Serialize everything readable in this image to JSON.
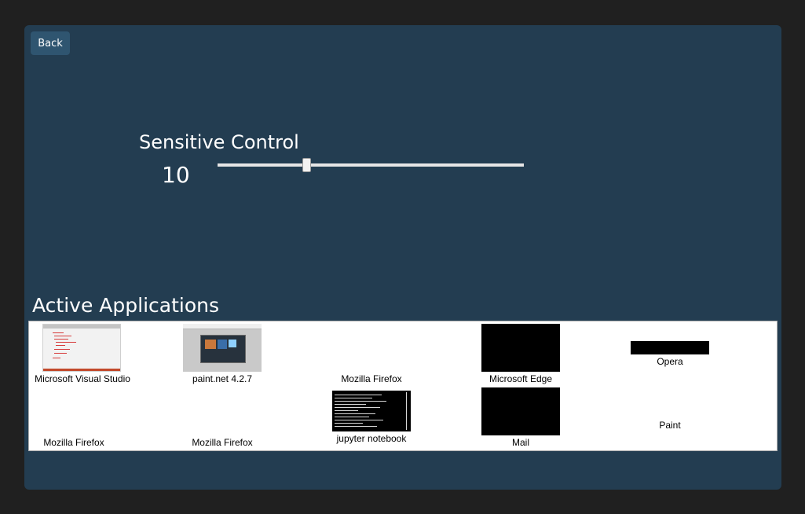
{
  "back_button": {
    "label": "Back"
  },
  "slider": {
    "label": "Sensitive Control",
    "value": "10",
    "fraction": 0.29
  },
  "active_applications": {
    "heading": "Active Applications",
    "tiles": [
      {
        "label": "Microsoft Visual Studio",
        "thumbnail": "code-editor-screenshot"
      },
      {
        "label": "paint.net 4.2.7",
        "thumbnail": "image-editor-screenshot"
      },
      {
        "label": "Mozilla Firefox",
        "thumbnail": "none"
      },
      {
        "label": "Microsoft Edge",
        "thumbnail": "black"
      },
      {
        "label": "Opera",
        "thumbnail": "black-bar"
      },
      {
        "label": "Mozilla Firefox",
        "thumbnail": "none"
      },
      {
        "label": "Mozilla Firefox",
        "thumbnail": "none"
      },
      {
        "label": "jupyter  notebook",
        "thumbnail": "terminal-screenshot"
      },
      {
        "label": "Mail",
        "thumbnail": "black"
      },
      {
        "label": "Paint",
        "thumbnail": "none"
      }
    ]
  },
  "colors": {
    "page_background": "#202020",
    "panel_background": "#233d51",
    "button_background": "#2f5570",
    "text": "#ffffff",
    "apps_background": "#ffffff"
  }
}
